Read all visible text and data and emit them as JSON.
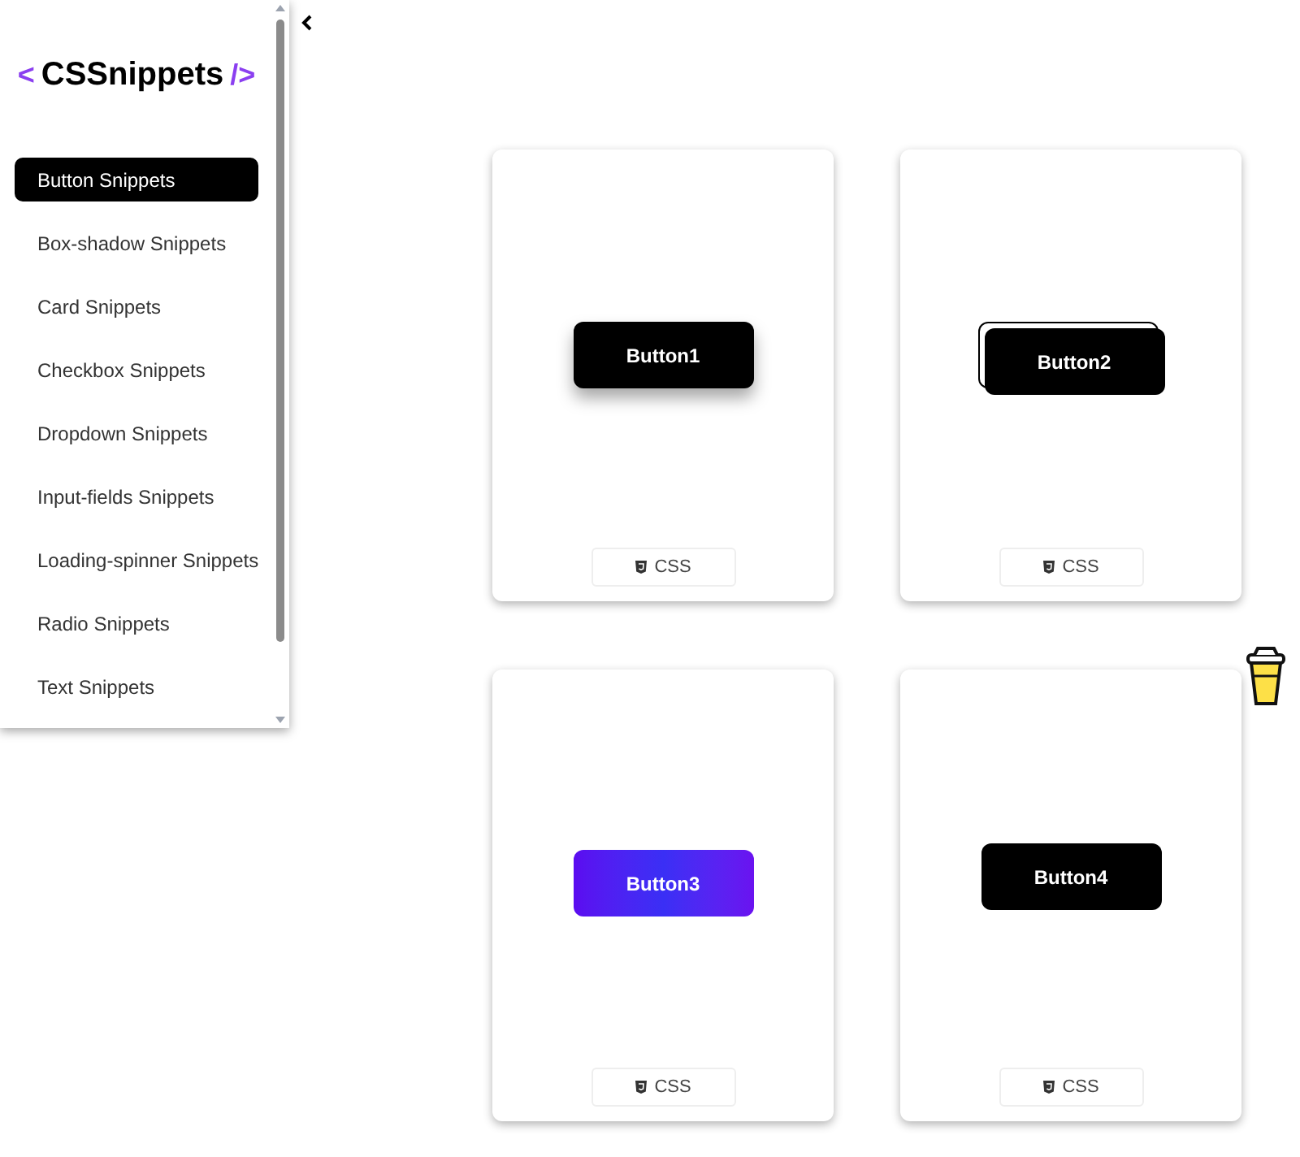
{
  "logo": {
    "open": "<",
    "name": "CSSnippets",
    "close": "/>"
  },
  "sidebar": {
    "items": [
      {
        "label": "Button Snippets",
        "selected": true
      },
      {
        "label": "Box-shadow Snippets",
        "selected": false
      },
      {
        "label": "Card Snippets",
        "selected": false
      },
      {
        "label": "Checkbox Snippets",
        "selected": false
      },
      {
        "label": "Dropdown Snippets",
        "selected": false
      },
      {
        "label": "Input-fields Snippets",
        "selected": false
      },
      {
        "label": "Loading-spinner Snippets",
        "selected": false
      },
      {
        "label": "Radio Snippets",
        "selected": false
      },
      {
        "label": "Text Snippets",
        "selected": false
      }
    ]
  },
  "cards": [
    {
      "kind": "shadow",
      "button": "Button1",
      "tab": "CSS"
    },
    {
      "kind": "offset-border",
      "button": "Button2",
      "tab": "CSS"
    },
    {
      "kind": "gradient",
      "button": "Button3",
      "tab": "CSS"
    },
    {
      "kind": "plain",
      "button": "Button4",
      "tab": "CSS"
    }
  ]
}
